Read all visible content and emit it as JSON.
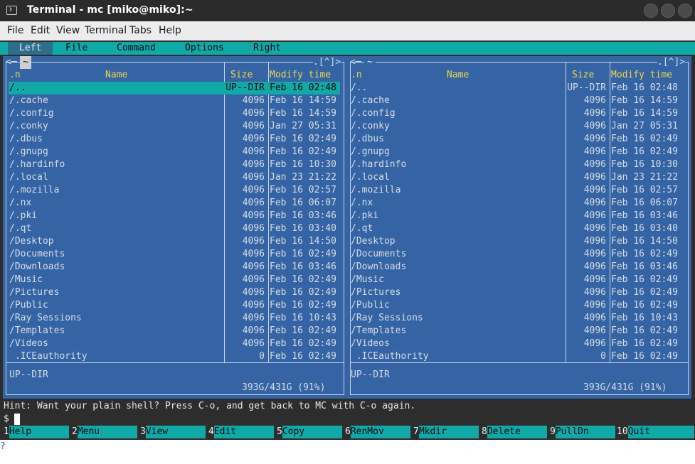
{
  "window": {
    "title": "Terminal - mc [miko@miko]:~",
    "icon": "terminal-icon",
    "controls": [
      "minimize-icon",
      "maximize-icon",
      "close-icon"
    ]
  },
  "menubar": [
    "File",
    "Edit",
    "View",
    "Terminal",
    "Tabs",
    "Help"
  ],
  "mc_menu": [
    "Left",
    "File",
    "Command",
    "Options",
    "Right"
  ],
  "left_panel": {
    "path": "~",
    "corner": ".[^]>",
    "header": {
      "sort": ".n",
      "name": "Name",
      "size": "Size",
      "mtime": "Modify time"
    },
    "status": "UP--DIR",
    "disk": "393G/431G (91%)"
  },
  "right_panel": {
    "path": "~",
    "corner": ".[^]>",
    "header": {
      "sort": ".n",
      "name": "Name",
      "size": "Size",
      "mtime": "Modify time"
    },
    "status": "UP--DIR",
    "disk": "393G/431G (91%)"
  },
  "files": [
    {
      "name": "/..",
      "size": "UP--DIR",
      "mtime": "Feb 16 02:48"
    },
    {
      "name": "/.cache",
      "size": "4096",
      "mtime": "Feb 16 14:59"
    },
    {
      "name": "/.config",
      "size": "4096",
      "mtime": "Feb 16 14:59"
    },
    {
      "name": "/.conky",
      "size": "4096",
      "mtime": "Jan 27 05:31"
    },
    {
      "name": "/.dbus",
      "size": "4096",
      "mtime": "Feb 16 02:49"
    },
    {
      "name": "/.gnupg",
      "size": "4096",
      "mtime": "Feb 16 02:49"
    },
    {
      "name": "/.hardinfo",
      "size": "4096",
      "mtime": "Feb 16 10:30"
    },
    {
      "name": "/.local",
      "size": "4096",
      "mtime": "Jan 23 21:22"
    },
    {
      "name": "/.mozilla",
      "size": "4096",
      "mtime": "Feb 16 02:57"
    },
    {
      "name": "/.nx",
      "size": "4096",
      "mtime": "Feb 16 06:07"
    },
    {
      "name": "/.pki",
      "size": "4096",
      "mtime": "Feb 16 03:46"
    },
    {
      "name": "/.qt",
      "size": "4096",
      "mtime": "Feb 16 03:40"
    },
    {
      "name": "/Desktop",
      "size": "4096",
      "mtime": "Feb 16 14:50"
    },
    {
      "name": "/Documents",
      "size": "4096",
      "mtime": "Feb 16 02:49"
    },
    {
      "name": "/Downloads",
      "size": "4096",
      "mtime": "Feb 16 03:46"
    },
    {
      "name": "/Music",
      "size": "4096",
      "mtime": "Feb 16 02:49"
    },
    {
      "name": "/Pictures",
      "size": "4096",
      "mtime": "Feb 16 02:49"
    },
    {
      "name": "/Public",
      "size": "4096",
      "mtime": "Feb 16 02:49"
    },
    {
      "name": "/Ray Sessions",
      "size": "4096",
      "mtime": "Feb 16 10:43"
    },
    {
      "name": "/Templates",
      "size": "4096",
      "mtime": "Feb 16 02:49"
    },
    {
      "name": "/Videos",
      "size": "4096",
      "mtime": "Feb 16 02:49"
    },
    {
      "name": " .ICEauthority",
      "size": "0",
      "mtime": "Feb 16 02:49"
    }
  ],
  "hint": "Hint: Want your plain shell? Press C-o, and get back to MC with C-o again.",
  "prompt": "$",
  "fkeys": [
    {
      "num": "1",
      "label": "Help"
    },
    {
      "num": "2",
      "label": "Menu"
    },
    {
      "num": "3",
      "label": "View"
    },
    {
      "num": "4",
      "label": "Edit"
    },
    {
      "num": "5",
      "label": "Copy"
    },
    {
      "num": "6",
      "label": "RenMov"
    },
    {
      "num": "7",
      "label": "Mkdir"
    },
    {
      "num": "8",
      "label": "Delete"
    },
    {
      "num": "9",
      "label": "PullDn"
    },
    {
      "num": "10",
      "label": "Quit"
    }
  ],
  "stray": "?"
}
